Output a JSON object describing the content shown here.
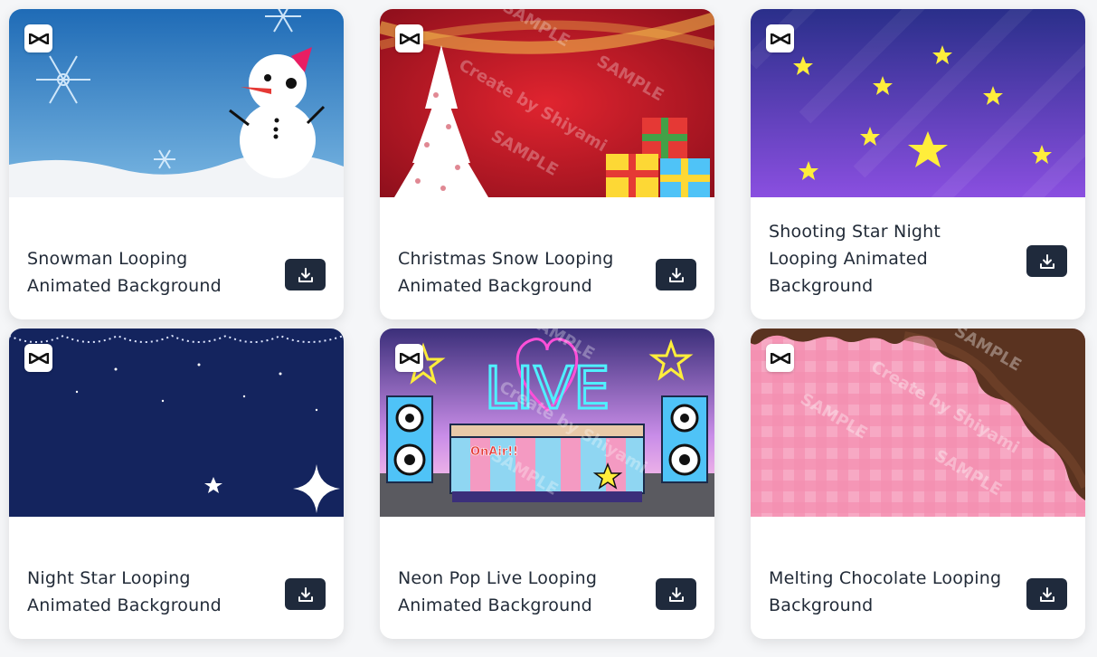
{
  "cards": [
    {
      "title": "Snowman Looping Animated Background",
      "logo_icon": "capcut-logo-icon",
      "action_icon": "download-icon"
    },
    {
      "title": "Christmas Snow Looping Animated Background",
      "logo_icon": "capcut-logo-icon",
      "action_icon": "download-icon"
    },
    {
      "title": "Shooting Star Night Looping Animated Background",
      "logo_icon": "capcut-logo-icon",
      "action_icon": "download-icon"
    },
    {
      "title": "Night Star Looping Animated Background",
      "logo_icon": "capcut-logo-icon",
      "action_icon": "download-icon"
    },
    {
      "title": "Neon Pop Live Looping Animated Background",
      "logo_icon": "capcut-logo-icon",
      "action_icon": "download-icon"
    },
    {
      "title": "Melting Chocolate Looping Background",
      "logo_icon": "capcut-logo-icon",
      "action_icon": "download-icon"
    }
  ],
  "thumb_text": {
    "watermark": "SAMPLE",
    "credit": "Create by Shiyami",
    "live_sign": "LIVE",
    "onair_sign": "OnAir!!"
  },
  "colors": {
    "button": "#1f2a3c",
    "title_text": "#222b38",
    "snowman_sky": "#2f7bc4",
    "christmas_red": "#c3142a",
    "night_purple": "#6a45d0",
    "night_navy": "#14245e",
    "neon_pink": "#ff4fd8",
    "check_pink": "#f48fb1",
    "chocolate": "#5a3320"
  }
}
